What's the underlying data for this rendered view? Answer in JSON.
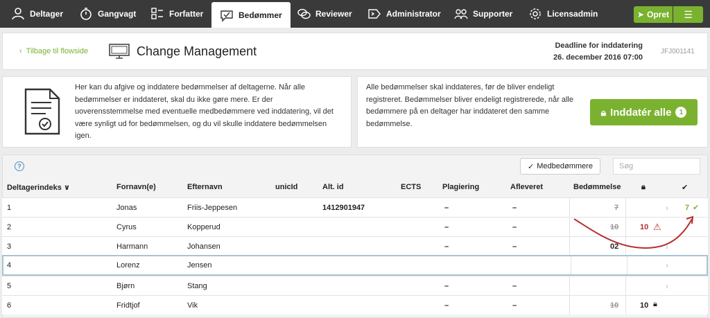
{
  "nav": {
    "items": [
      {
        "label": "Deltager",
        "icon": "user-icon"
      },
      {
        "label": "Gangvagt",
        "icon": "stopwatch-icon"
      },
      {
        "label": "Forfatter",
        "icon": "checklist-icon"
      },
      {
        "label": "Bedømmer",
        "icon": "speech-check-icon",
        "active": true
      },
      {
        "label": "Reviewer",
        "icon": "chat-bubbles-icon"
      },
      {
        "label": "Administrator",
        "icon": "arrow-tag-icon"
      },
      {
        "label": "Supporter",
        "icon": "group-icon"
      },
      {
        "label": "Licensadmin",
        "icon": "gear-icon"
      }
    ],
    "create_label": "Opret",
    "menu_icon": "hamburger-icon"
  },
  "header": {
    "back_label": "Tilbage til flowside",
    "title": "Change Management",
    "deadline_label": "Deadline for inddatering",
    "deadline_value": "26. december 2016 07:00",
    "case_id": "JFJ001141"
  },
  "info": {
    "left_text": "Her kan du afgive og inddatere bedømmelser af deltagerne. Når alle bedømmelser er inddateret, skal du ikke gøre mere. Er der uoverensstemmelse med eventuelle medbedømmere ved inddatering, vil det være synligt ud for bedømmelsen, og du vil skulle inddatere bedømmelsen igen.",
    "right_text": "Alle bedømmelser skal inddateres, før de bliver endeligt registreret. Bedømmelser bliver endeligt registrerede, når alle bedømmere på en deltager har inddateret den samme bedømmelse.",
    "submit_all_label": "Inddatér alle",
    "submit_all_count": "1"
  },
  "toolbar": {
    "co_assessors_label": "Medbedømmere",
    "search_placeholder": "Søg"
  },
  "table": {
    "headers": {
      "index": "Deltagerindeks",
      "firstname": "Fornavn(e)",
      "lastname": "Efternavn",
      "unicid": "unicId",
      "altid": "Alt. id",
      "ects": "ECTS",
      "plagiarism": "Plagiering",
      "submitted": "Afleveret",
      "grade": "Bedømmelse"
    },
    "rows": [
      {
        "index": "1",
        "firstname": "Jonas",
        "lastname": "Friis-Jeppesen",
        "altid": "1412901947",
        "plagiarism": "–",
        "submitted": "–",
        "grade": "7",
        "grade_struck": true,
        "final": "7"
      },
      {
        "index": "2",
        "firstname": "Cyrus",
        "lastname": "Kopperud",
        "altid": "",
        "plagiarism": "–",
        "submitted": "–",
        "grade": "10",
        "grade_struck": true,
        "locked": "10"
      },
      {
        "index": "3",
        "firstname": "Harmann",
        "lastname": "Johansen",
        "altid": "",
        "plagiarism": "–",
        "submitted": "–",
        "grade": "02",
        "grade_struck": false
      },
      {
        "index": "4",
        "firstname": "Lorenz",
        "lastname": "Jensen",
        "altid": "",
        "plagiarism": "",
        "submitted": "",
        "grade": ""
      },
      {
        "index": "5",
        "firstname": "Bjørn",
        "lastname": "Stang",
        "altid": "",
        "plagiarism": "–",
        "submitted": "–",
        "grade": ""
      },
      {
        "index": "6",
        "firstname": "Fridtjof",
        "lastname": "Vik",
        "altid": "",
        "plagiarism": "–",
        "submitted": "–",
        "grade": "10",
        "grade_struck": true,
        "locked": "10"
      }
    ]
  },
  "colors": {
    "accent": "#7ab22f",
    "nav_bg": "#3a3a3a",
    "warning": "#b52e2e",
    "link": "#4a8ec9"
  }
}
